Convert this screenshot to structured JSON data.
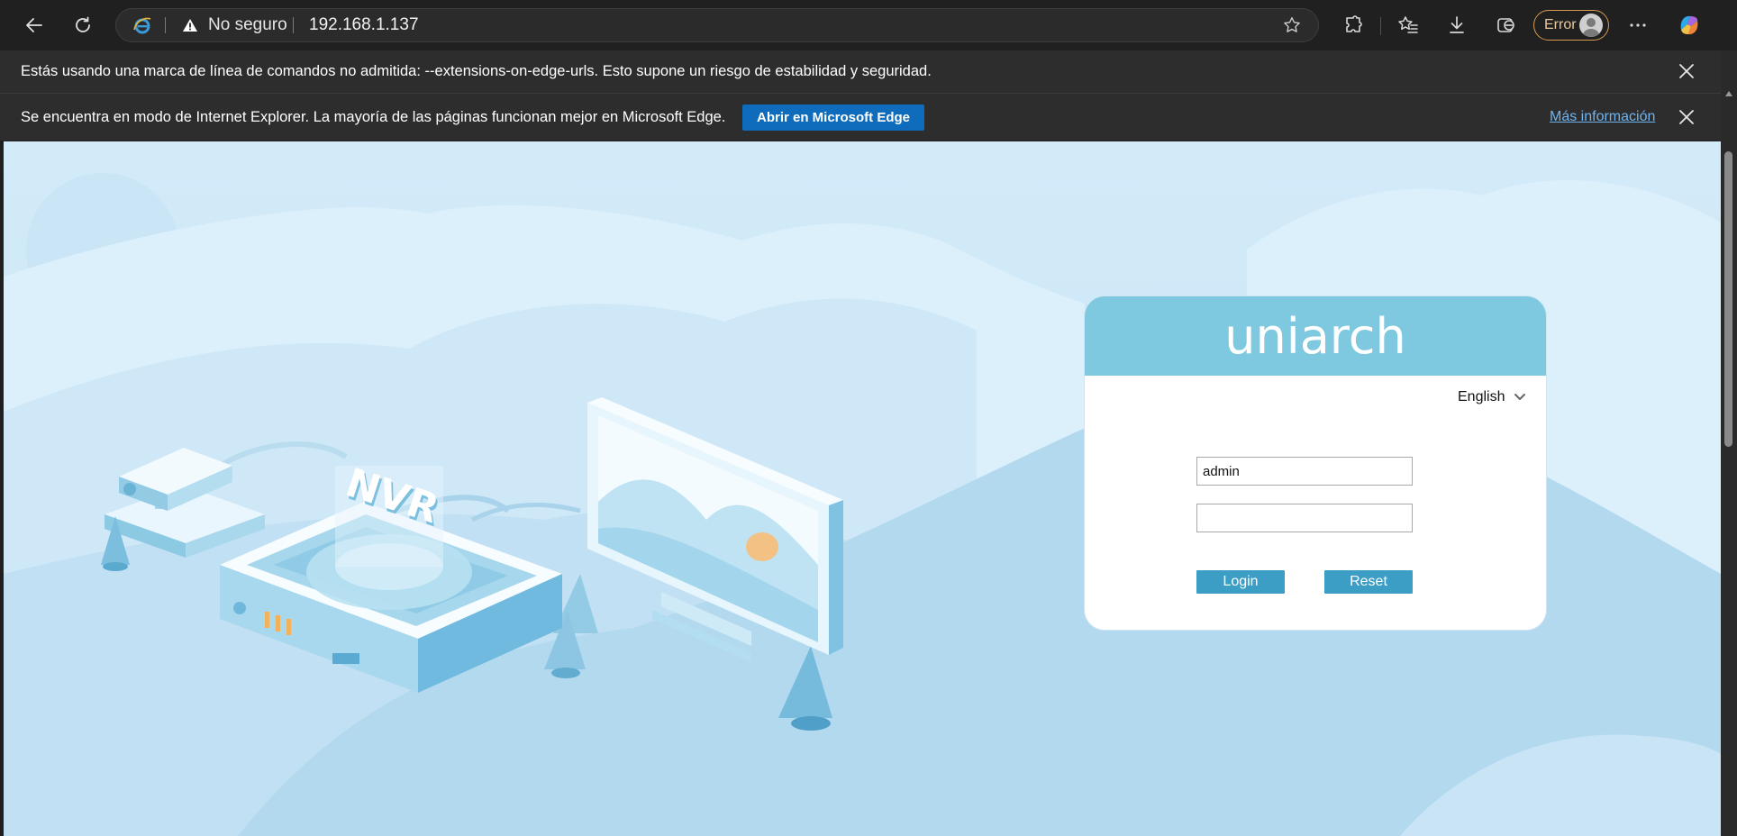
{
  "browser": {
    "security_label": "No seguro",
    "url": "192.168.1.137",
    "profile_label": "Error",
    "colors": {
      "frame": "#202020",
      "infobar": "#2d2d2d",
      "accent_button": "#0f6cbd",
      "profile_border": "#d79a4f"
    }
  },
  "infobars": {
    "flags_message": "Estás usando una marca de línea de comandos no admitida: --extensions-on-edge-urls. Esto supone un riesgo de estabilidad y seguridad.",
    "ie_mode_message": "Se encuentra en modo de Internet Explorer. La mayoría de las páginas funcionan mejor en Microsoft Edge.",
    "open_in_edge_label": "Abrir en Microsoft Edge",
    "more_info_label": "Más información"
  },
  "illustration": {
    "device_label": "NVR"
  },
  "login": {
    "brand": "uniarch",
    "language": "English",
    "username_value": "admin",
    "password_value": "",
    "login_label": "Login",
    "reset_label": "Reset",
    "colors": {
      "header": "#7ec9e0",
      "button": "#3d9ec5",
      "background": "#d6ecf9"
    }
  }
}
